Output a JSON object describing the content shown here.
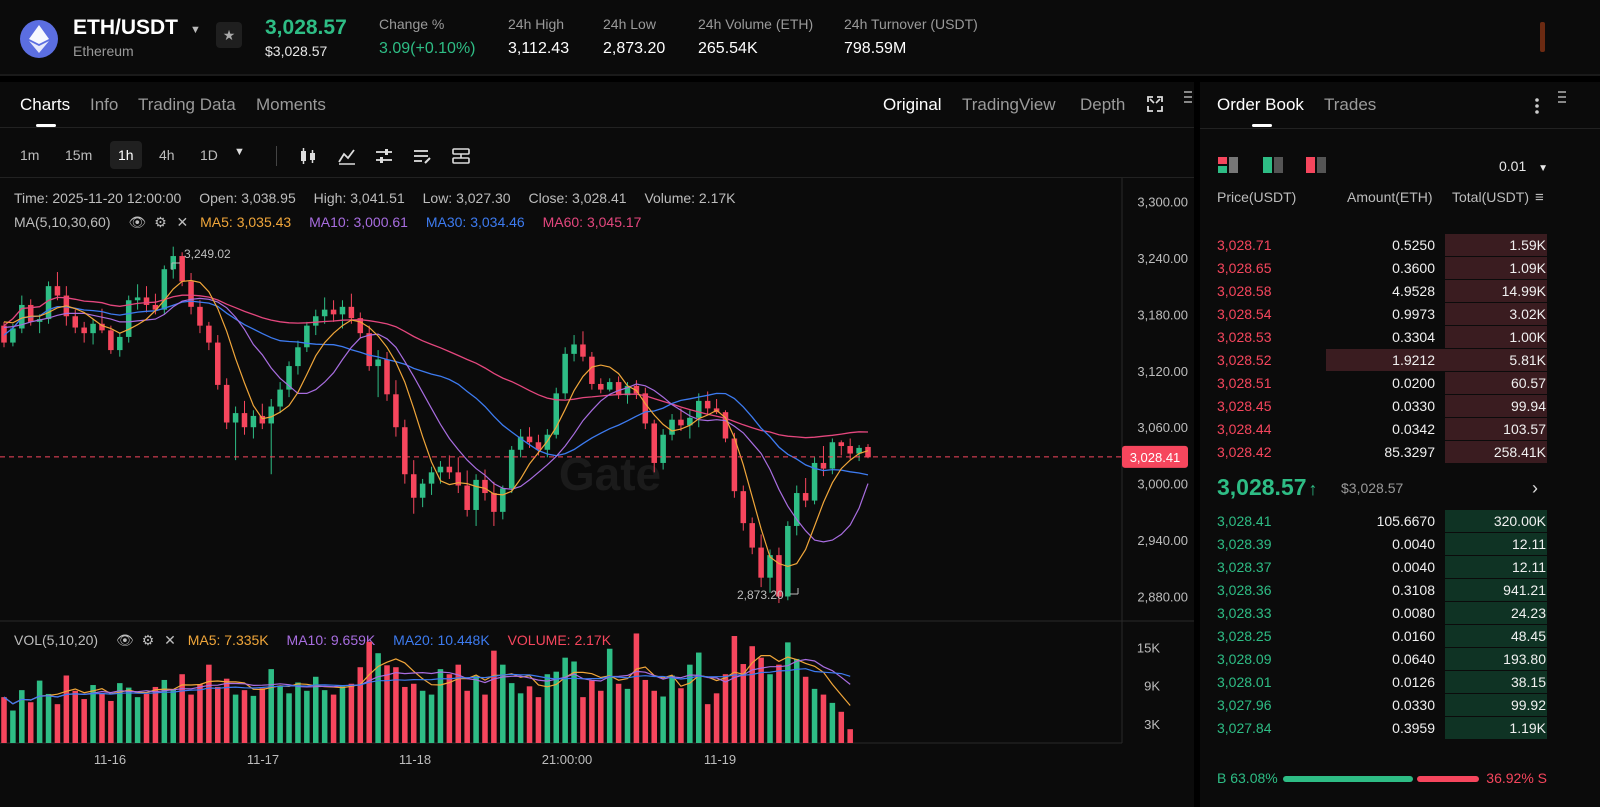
{
  "ticker": {
    "pair": "ETH/USDT",
    "name": "Ethereum",
    "last_price": "3,028.57",
    "last_price_usd": "$3,028.57",
    "change_label": "Change %",
    "change_value": "3.09(+0.10%)",
    "high_label": "24h High",
    "high_value": "3,112.43",
    "low_label": "24h Low",
    "low_value": "2,873.20",
    "volume_label": "24h Volume (ETH)",
    "volume_value": "265.54K",
    "turnover_label": "24h Turnover (USDT)",
    "turnover_value": "798.59M"
  },
  "chart_tabs": [
    "Charts",
    "Info",
    "Trading Data",
    "Moments"
  ],
  "view_tabs": [
    "Original",
    "TradingView",
    "Depth"
  ],
  "intervals": [
    "1m",
    "15m",
    "1h",
    "4h",
    "1D"
  ],
  "active_interval": "1h",
  "candle_info": {
    "time": "Time: 2025-11-20 12:00:00",
    "open": "Open: 3,038.95",
    "high": "High: 3,041.51",
    "low": "Low: 3,027.30",
    "close": "Close: 3,028.41",
    "volume": "Volume: 2.17K"
  },
  "ma_line": {
    "label": "MA(5,10,30,60)",
    "ma5": "MA5: 3,035.43",
    "ma10": "MA10: 3,000.61",
    "ma30": "MA30: 3,034.46",
    "ma60": "MA60: 3,045.17"
  },
  "vol_line": {
    "label": "VOL(5,10,20)",
    "ma5": "MA5: 7.335K",
    "ma10": "MA10: 9.659K",
    "ma20": "MA20: 10.448K",
    "volume": "VOLUME: 2.17K"
  },
  "colors": {
    "up": "#2ebd85",
    "down": "#f6465d",
    "ma5": "#f0a63a",
    "ma10": "#a86de0",
    "ma30": "#3d7bf0",
    "ma60": "#e4477e"
  },
  "chart_data": {
    "type": "candlestick",
    "price_axis": [
      "3,300.00",
      "3,240.00",
      "3,180.00",
      "3,120.00",
      "3,060.00",
      "3,000.00",
      "2,940.00",
      "2,880.00"
    ],
    "price_range": [
      2855,
      3325
    ],
    "volume_axis": [
      "15K",
      "9K",
      "3K"
    ],
    "volume_range": [
      0,
      19000
    ],
    "time_axis": [
      "11-16",
      "11-17",
      "11-18",
      "21:00:00",
      "11-19"
    ],
    "current_price_label": "3,028.41",
    "high_marker": "3,249.02",
    "low_marker": "2,873.20",
    "watermark": "Gate",
    "candles": [
      [
        3168,
        3172,
        3145,
        3150
      ],
      [
        3150,
        3170,
        3146,
        3165
      ],
      [
        3165,
        3200,
        3160,
        3190
      ],
      [
        3190,
        3196,
        3168,
        3172
      ],
      [
        3172,
        3180,
        3160,
        3175
      ],
      [
        3175,
        3215,
        3170,
        3210
      ],
      [
        3210,
        3225,
        3195,
        3200
      ],
      [
        3200,
        3210,
        3168,
        3178
      ],
      [
        3178,
        3185,
        3160,
        3166
      ],
      [
        3166,
        3172,
        3150,
        3160
      ],
      [
        3160,
        3175,
        3148,
        3170
      ],
      [
        3170,
        3186,
        3160,
        3163
      ],
      [
        3163,
        3168,
        3138,
        3142
      ],
      [
        3142,
        3160,
        3135,
        3156
      ],
      [
        3156,
        3200,
        3150,
        3195
      ],
      [
        3195,
        3212,
        3185,
        3198
      ],
      [
        3198,
        3210,
        3182,
        3190
      ],
      [
        3190,
        3202,
        3180,
        3185
      ],
      [
        3185,
        3232,
        3180,
        3228
      ],
      [
        3228,
        3252,
        3218,
        3242
      ],
      [
        3242,
        3246,
        3210,
        3215
      ],
      [
        3215,
        3224,
        3180,
        3188
      ],
      [
        3188,
        3195,
        3160,
        3168
      ],
      [
        3168,
        3172,
        3142,
        3150
      ],
      [
        3150,
        3158,
        3100,
        3105
      ],
      [
        3105,
        3112,
        3058,
        3065
      ],
      [
        3065,
        3082,
        3025,
        3075
      ],
      [
        3075,
        3088,
        3052,
        3060
      ],
      [
        3060,
        3078,
        3048,
        3072
      ],
      [
        3072,
        3085,
        3058,
        3064
      ],
      [
        3064,
        3090,
        3010,
        3082
      ],
      [
        3082,
        3108,
        3075,
        3100
      ],
      [
        3100,
        3130,
        3092,
        3125
      ],
      [
        3125,
        3152,
        3116,
        3145
      ],
      [
        3145,
        3172,
        3140,
        3168
      ],
      [
        3168,
        3185,
        3158,
        3178
      ],
      [
        3178,
        3198,
        3170,
        3185
      ],
      [
        3185,
        3195,
        3172,
        3180
      ],
      [
        3180,
        3195,
        3165,
        3188
      ],
      [
        3188,
        3202,
        3170,
        3176
      ],
      [
        3176,
        3182,
        3155,
        3160
      ],
      [
        3160,
        3168,
        3120,
        3125
      ],
      [
        3125,
        3142,
        3092,
        3132
      ],
      [
        3132,
        3140,
        3088,
        3095
      ],
      [
        3095,
        3110,
        3050,
        3060
      ],
      [
        3060,
        3068,
        3000,
        3010
      ],
      [
        3010,
        3025,
        2968,
        2985
      ],
      [
        2985,
        3005,
        2975,
        3000
      ],
      [
        3000,
        3018,
        2988,
        3012
      ],
      [
        3012,
        3024,
        3000,
        3018
      ],
      [
        3018,
        3030,
        3005,
        3012
      ],
      [
        3012,
        3028,
        2990,
        2998
      ],
      [
        2998,
        3014,
        2965,
        2972
      ],
      [
        2972,
        3010,
        2955,
        3004
      ],
      [
        3004,
        3015,
        2982,
        2990
      ],
      [
        2990,
        3002,
        2955,
        2970
      ],
      [
        2970,
        2998,
        2962,
        2995
      ],
      [
        2995,
        3040,
        2990,
        3036
      ],
      [
        3036,
        3058,
        3028,
        3050
      ],
      [
        3050,
        3060,
        3038,
        3044
      ],
      [
        3044,
        3052,
        3030,
        3036
      ],
      [
        3036,
        3058,
        3028,
        3052
      ],
      [
        3052,
        3102,
        3048,
        3096
      ],
      [
        3096,
        3145,
        3090,
        3138
      ],
      [
        3138,
        3158,
        3130,
        3148
      ],
      [
        3148,
        3162,
        3130,
        3135
      ],
      [
        3135,
        3140,
        3100,
        3106
      ],
      [
        3106,
        3112,
        3096,
        3100
      ],
      [
        3100,
        3112,
        3098,
        3108
      ],
      [
        3108,
        3114,
        3090,
        3094
      ],
      [
        3094,
        3108,
        3085,
        3104
      ],
      [
        3104,
        3110,
        3090,
        3096
      ],
      [
        3096,
        3102,
        3058,
        3064
      ],
      [
        3064,
        3068,
        3012,
        3022
      ],
      [
        3022,
        3058,
        3015,
        3052
      ],
      [
        3052,
        3074,
        3046,
        3068
      ],
      [
        3068,
        3080,
        3056,
        3062
      ],
      [
        3062,
        3078,
        3048,
        3070
      ],
      [
        3070,
        3096,
        3060,
        3088
      ],
      [
        3088,
        3098,
        3074,
        3080
      ],
      [
        3080,
        3090,
        3074,
        3076
      ],
      [
        3076,
        3078,
        3044,
        3048
      ],
      [
        3048,
        3054,
        2985,
        2992
      ],
      [
        2992,
        2998,
        2950,
        2958
      ],
      [
        2958,
        2964,
        2925,
        2932
      ],
      [
        2932,
        2946,
        2890,
        2900
      ],
      [
        2900,
        2930,
        2884,
        2924
      ],
      [
        2924,
        2932,
        2873,
        2880
      ],
      [
        2880,
        2960,
        2876,
        2955
      ],
      [
        2955,
        2998,
        2945,
        2990
      ],
      [
        2990,
        3006,
        2975,
        2982
      ],
      [
        2982,
        3028,
        2978,
        3022
      ],
      [
        3022,
        3040,
        3008,
        3016
      ],
      [
        3016,
        3048,
        3010,
        3044
      ],
      [
        3044,
        3046,
        3030,
        3040
      ],
      [
        3040,
        3048,
        3026,
        3032
      ],
      [
        3032,
        3041,
        3024,
        3038
      ],
      [
        3039,
        3042,
        3027,
        3028
      ]
    ],
    "volumes": [
      7200,
      5100,
      8300,
      6400,
      9800,
      7700,
      6100,
      10600,
      8200,
      6900,
      9100,
      7800,
      6600,
      9400,
      8700,
      7200,
      7700,
      8800,
      9900,
      8400,
      10800,
      7600,
      9200,
      12300,
      8800,
      10100,
      7600,
      8300,
      7400,
      8600,
      11600,
      9000,
      7800,
      9500,
      8200,
      10400,
      8300,
      7600,
      8900,
      9300,
      11900,
      15900,
      14100,
      12200,
      11900,
      8800,
      9300,
      8200,
      7600,
      11600,
      10800,
      12300,
      8200,
      10500,
      7600,
      14500,
      12300,
      9400,
      7800,
      8900,
      7200,
      10800,
      11200,
      13400,
      12800,
      7200,
      9800,
      8200,
      14800,
      9300,
      8500,
      17200,
      9900,
      8200,
      7300,
      10600,
      8600,
      12300,
      14200,
      6100,
      7800,
      10800,
      16800,
      12400,
      15200,
      13400,
      10800,
      12300,
      15800,
      13200,
      10400,
      8500,
      7600,
      6300,
      4900,
      2170
    ],
    "ma5": [
      3172,
      3171,
      3176,
      3178,
      3178,
      3182,
      3187,
      3189,
      3186,
      3182,
      3175,
      3168,
      3165,
      3160,
      3164,
      3169,
      3175,
      3184,
      3195,
      3207,
      3215,
      3216,
      3214,
      3204,
      3186,
      3162,
      3133,
      3107,
      3083,
      3069,
      3071,
      3076,
      3083,
      3097,
      3116,
      3136,
      3150,
      3160,
      3168,
      3174,
      3172,
      3166,
      3157,
      3145,
      3129,
      3108,
      3080,
      3050,
      3023,
      3003,
      2999,
      3001,
      3000,
      2997,
      2995,
      2989,
      2988,
      2992,
      3005,
      3021,
      3033,
      3045,
      3060,
      3079,
      3099,
      3114,
      3124,
      3126,
      3124,
      3117,
      3104,
      3099,
      3085,
      3073,
      3063,
      3056,
      3058,
      3062,
      3069,
      3073,
      3078,
      3070,
      3049,
      3020,
      2986,
      2952,
      2922,
      2915,
      2912,
      2915,
      2930,
      2955,
      2980,
      3001,
      3016,
      3025,
      3032,
      3035
    ],
    "ma10": [
      3166,
      3167,
      3169,
      3172,
      3174,
      3176,
      3179,
      3181,
      3181,
      3181,
      3179,
      3177,
      3175,
      3172,
      3172,
      3173,
      3174,
      3175,
      3180,
      3188,
      3194,
      3196,
      3197,
      3196,
      3193,
      3187,
      3177,
      3164,
      3148,
      3137,
      3123,
      3112,
      3104,
      3096,
      3096,
      3100,
      3108,
      3118,
      3132,
      3145,
      3155,
      3158,
      3159,
      3154,
      3145,
      3130,
      3114,
      3097,
      3080,
      3063,
      3048,
      3036,
      3025,
      3016,
      3009,
      3000,
      2995,
      2994,
      2997,
      3004,
      3012,
      3020,
      3029,
      3040,
      3053,
      3067,
      3078,
      3088,
      3095,
      3099,
      3102,
      3106,
      3104,
      3099,
      3092,
      3084,
      3078,
      3072,
      3068,
      3067,
      3068,
      3067,
      3061,
      3054,
      3043,
      3032,
      3015,
      2994,
      2976,
      2962,
      2950,
      2940,
      2938,
      2940,
      2946,
      2956,
      2974,
      3000
    ]
  },
  "order_book": {
    "tabs": [
      "Order Book",
      "Trades"
    ],
    "precision": "0.01",
    "headers": {
      "price": "Price(USDT)",
      "amount": "Amount(ETH)",
      "total": "Total(USDT)"
    },
    "asks": [
      {
        "price": "3,028.71",
        "amount": "0.5250",
        "total": "1.59K",
        "depth": 0.31
      },
      {
        "price": "3,028.65",
        "amount": "0.3600",
        "total": "1.09K",
        "depth": 0.31
      },
      {
        "price": "3,028.58",
        "amount": "4.9528",
        "total": "14.99K",
        "depth": 0.31
      },
      {
        "price": "3,028.54",
        "amount": "0.9973",
        "total": "3.02K",
        "depth": 0.31
      },
      {
        "price": "3,028.53",
        "amount": "0.3304",
        "total": "1.00K",
        "depth": 0.31
      },
      {
        "price": "3,028.52",
        "amount": "1.9212",
        "total": "5.81K",
        "depth": 0.67
      },
      {
        "price": "3,028.51",
        "amount": "0.0200",
        "total": "60.57",
        "depth": 0.31
      },
      {
        "price": "3,028.45",
        "amount": "0.0330",
        "total": "99.94",
        "depth": 0.31
      },
      {
        "price": "3,028.44",
        "amount": "0.0342",
        "total": "103.57",
        "depth": 0.31
      },
      {
        "price": "3,028.42",
        "amount": "85.3297",
        "total": "258.41K",
        "depth": 0.31
      }
    ],
    "mid_price": "3,028.57",
    "mid_arrow": "↑",
    "mid_usd": "$3,028.57",
    "bids": [
      {
        "price": "3,028.41",
        "amount": "105.6670",
        "total": "320.00K",
        "depth": 0.31
      },
      {
        "price": "3,028.39",
        "amount": "0.0040",
        "total": "12.11",
        "depth": 0.31
      },
      {
        "price": "3,028.37",
        "amount": "0.0040",
        "total": "12.11",
        "depth": 0.31
      },
      {
        "price": "3,028.36",
        "amount": "0.3108",
        "total": "941.21",
        "depth": 0.31
      },
      {
        "price": "3,028.33",
        "amount": "0.0080",
        "total": "24.23",
        "depth": 0.31
      },
      {
        "price": "3,028.25",
        "amount": "0.0160",
        "total": "48.45",
        "depth": 0.31
      },
      {
        "price": "3,028.09",
        "amount": "0.0640",
        "total": "193.80",
        "depth": 0.31
      },
      {
        "price": "3,028.01",
        "amount": "0.0126",
        "total": "38.15",
        "depth": 0.31
      },
      {
        "price": "3,027.96",
        "amount": "0.0330",
        "total": "99.92",
        "depth": 0.31
      },
      {
        "price": "3,027.84",
        "amount": "0.3959",
        "total": "1.19K",
        "depth": 0.31
      }
    ],
    "buy_ratio": "B 63.08%",
    "sell_ratio": "36.92% S"
  }
}
